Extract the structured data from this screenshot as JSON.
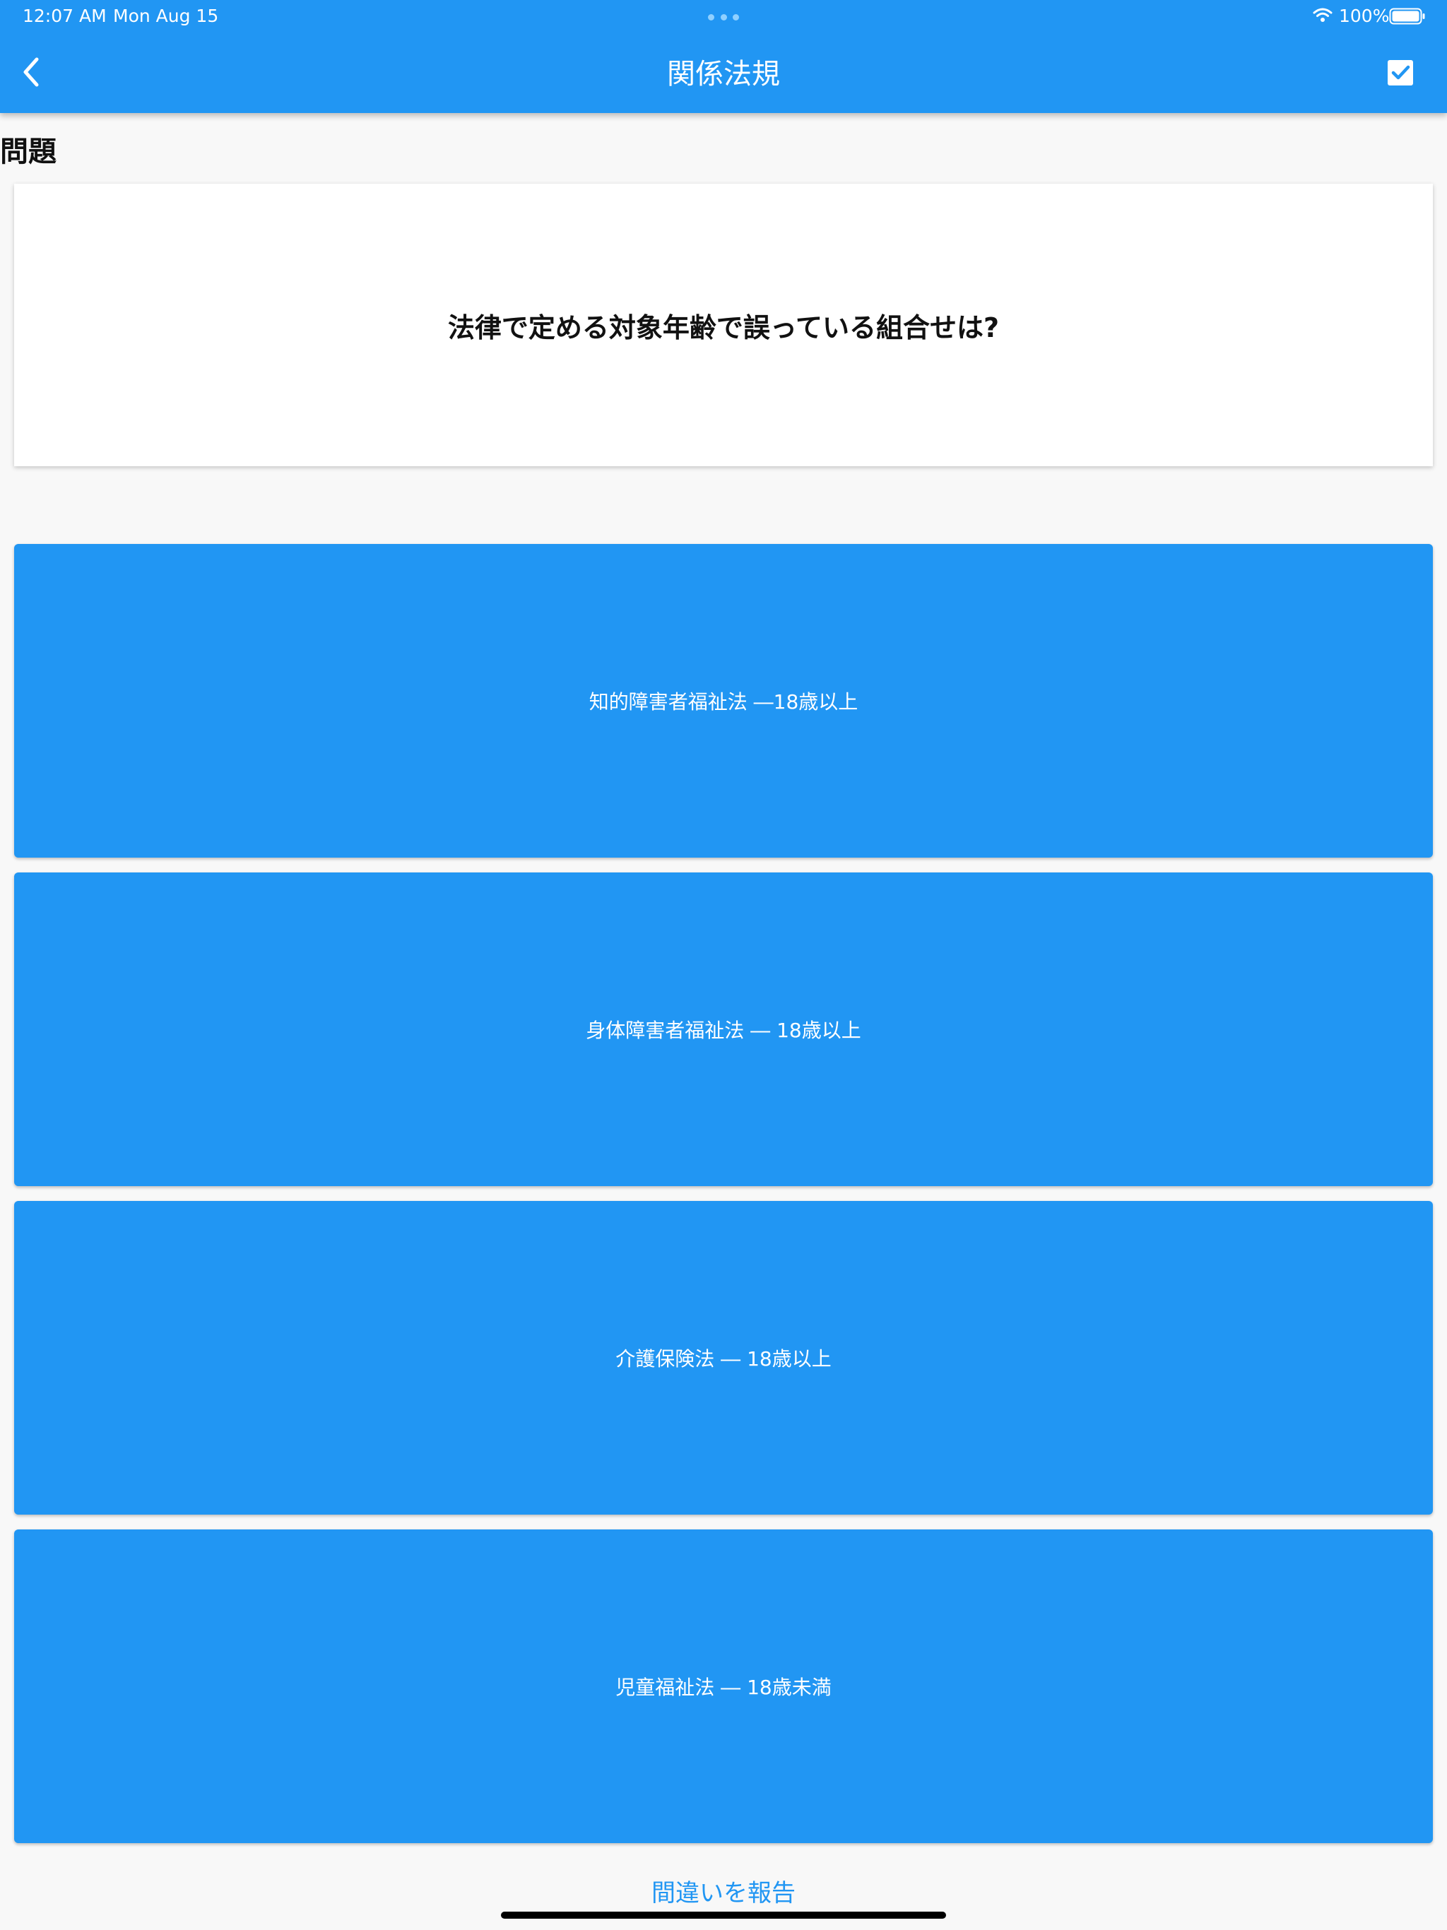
{
  "status_bar": {
    "time": "12:07 AM",
    "date": "Mon Aug 15",
    "battery": "100%"
  },
  "header": {
    "title": "関係法規"
  },
  "question": {
    "label": "問題",
    "text": "法律で定める対象年齢で誤っている組合せは?"
  },
  "answers": [
    {
      "label": "知的障害者福祉法 ―18歳以上"
    },
    {
      "label": "身体障害者福祉法 ― 18歳以上"
    },
    {
      "label": "介護保険法 ― 18歳以上"
    },
    {
      "label": "児童福祉法 ― 18歳未満"
    }
  ],
  "footer": {
    "report_label": "間違いを報告"
  },
  "colors": {
    "primary": "#2196f3",
    "background": "#f8f8f8",
    "card": "#ffffff"
  },
  "icons": [
    "back-icon",
    "check-icon",
    "wifi-icon",
    "battery-icon"
  ]
}
